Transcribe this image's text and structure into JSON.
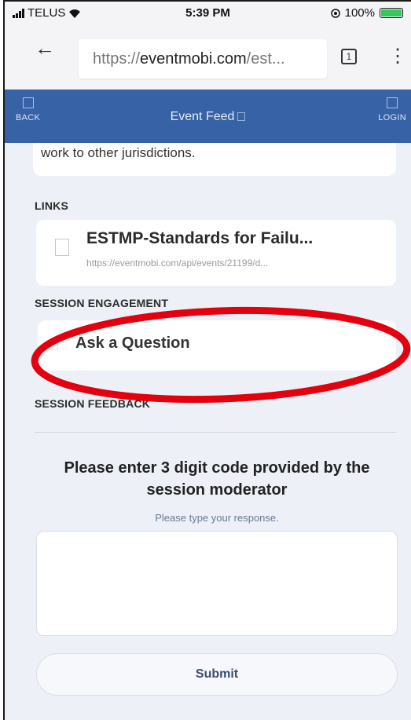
{
  "status_bar": {
    "carrier": "TELUS",
    "time": "5:39 PM",
    "battery": "100%"
  },
  "browser": {
    "url_prefix": "https://",
    "url_domain": "eventmobi.com",
    "url_suffix": "/est...",
    "tab_count": "1"
  },
  "header": {
    "back_label": "BACK",
    "title": "Event Feed",
    "login_label": "LOGIN",
    "color": "#3762a6"
  },
  "content": {
    "description_tail": "work to other jurisdictions.",
    "links_label": "LINKS",
    "link": {
      "title": "ESTMP-Standards for Failu...",
      "url": "https://eventmobi.com/api/events/21199/d..."
    },
    "engagement_label": "SESSION ENGAGEMENT",
    "ask_question_label": "Ask a Question",
    "feedback_label": "SESSION FEEDBACK",
    "prompt": "Please enter 3 digit code provided by the session moderator",
    "hint": "Please type your response.",
    "response_value": "",
    "submit_label": "Submit"
  },
  "annotation": {
    "color": "#e3000f"
  }
}
